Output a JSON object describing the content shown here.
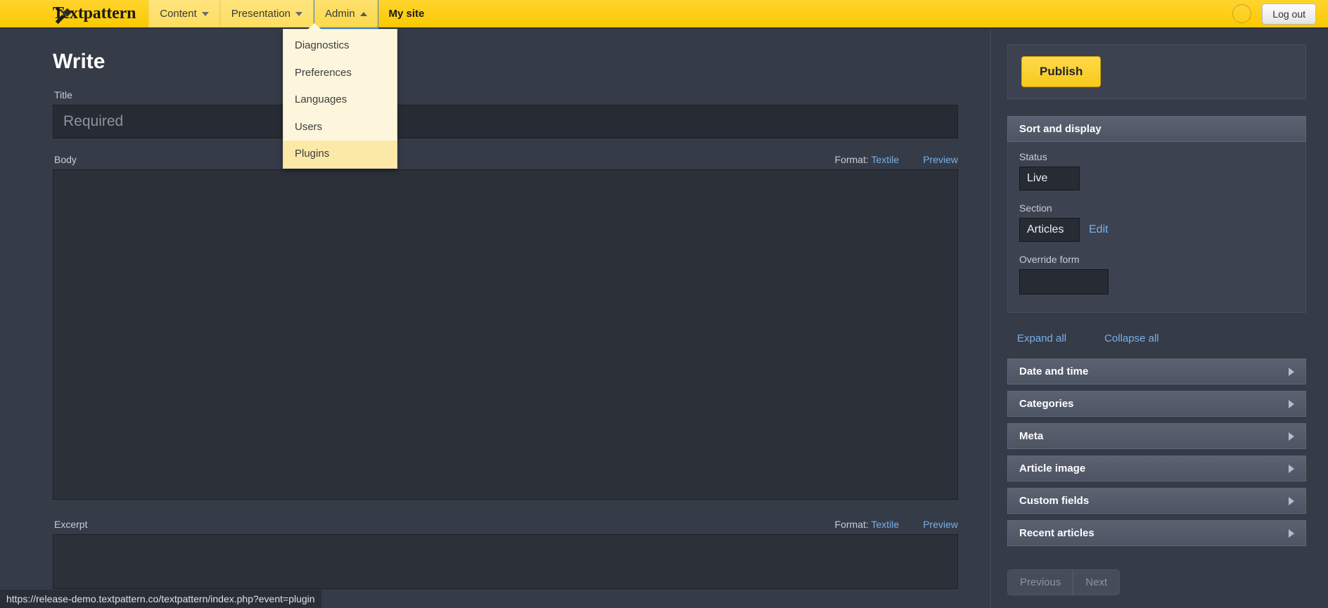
{
  "navbar": {
    "brand": "Textpattern",
    "brand_icon": "hammer-brush-icon",
    "items": [
      {
        "label": "Content",
        "caret": "chevron-down-icon",
        "state": "tint"
      },
      {
        "label": "Presentation",
        "caret": "chevron-down-icon",
        "state": "tint"
      },
      {
        "label": "Admin",
        "caret": "chevron-up-icon",
        "state": "active"
      },
      {
        "label": "My site",
        "caret": "",
        "state": "bold"
      }
    ],
    "avatar": "user-avatar",
    "logout_label": "Log out"
  },
  "dropdown": {
    "open_for": "Admin",
    "items": [
      {
        "label": "Diagnostics",
        "highlighted": false
      },
      {
        "label": "Preferences",
        "highlighted": false
      },
      {
        "label": "Languages",
        "highlighted": false
      },
      {
        "label": "Users",
        "highlighted": false
      },
      {
        "label": "Plugins",
        "highlighted": true
      }
    ]
  },
  "main": {
    "page_title": "Write",
    "title_label": "Title",
    "title_value": "",
    "title_placeholder": "Required",
    "body_label": "Body",
    "body_value": "",
    "body_format_prefix": "Format:",
    "body_format_value": "Textile",
    "body_preview_label": "Preview",
    "excerpt_label": "Excerpt",
    "excerpt_value": "",
    "excerpt_format_prefix": "Format:",
    "excerpt_format_value": "Textile",
    "excerpt_preview_label": "Preview"
  },
  "sidebar": {
    "publish_label": "Publish",
    "sort_display": {
      "title": "Sort and display",
      "status_label": "Status",
      "status_value": "Live",
      "section_label": "Section",
      "section_value": "Articles",
      "section_edit_label": "Edit",
      "override_label": "Override form",
      "override_value": ""
    },
    "expand_all_label": "Expand all",
    "collapse_all_label": "Collapse all",
    "accordions": [
      {
        "title": "Date and time",
        "icon": "chevron-right-icon"
      },
      {
        "title": "Categories",
        "icon": "chevron-right-icon"
      },
      {
        "title": "Meta",
        "icon": "chevron-right-icon"
      },
      {
        "title": "Article image",
        "icon": "chevron-right-icon"
      },
      {
        "title": "Custom fields",
        "icon": "chevron-right-icon"
      },
      {
        "title": "Recent articles",
        "icon": "chevron-right-icon"
      }
    ],
    "pager": {
      "previous_label": "Previous",
      "next_label": "Next"
    }
  },
  "statusbar": {
    "url": "https://release-demo.textpattern.co/textpattern/index.php?event=plugin"
  },
  "colors": {
    "brand_yellow": "#fcc900",
    "accent_link": "#79b0e8",
    "page_bg": "#353b47",
    "panel_bg": "#3c4250",
    "dropdown_bg": "#fdf6dd",
    "dropdown_highlight": "#fce9a8"
  }
}
